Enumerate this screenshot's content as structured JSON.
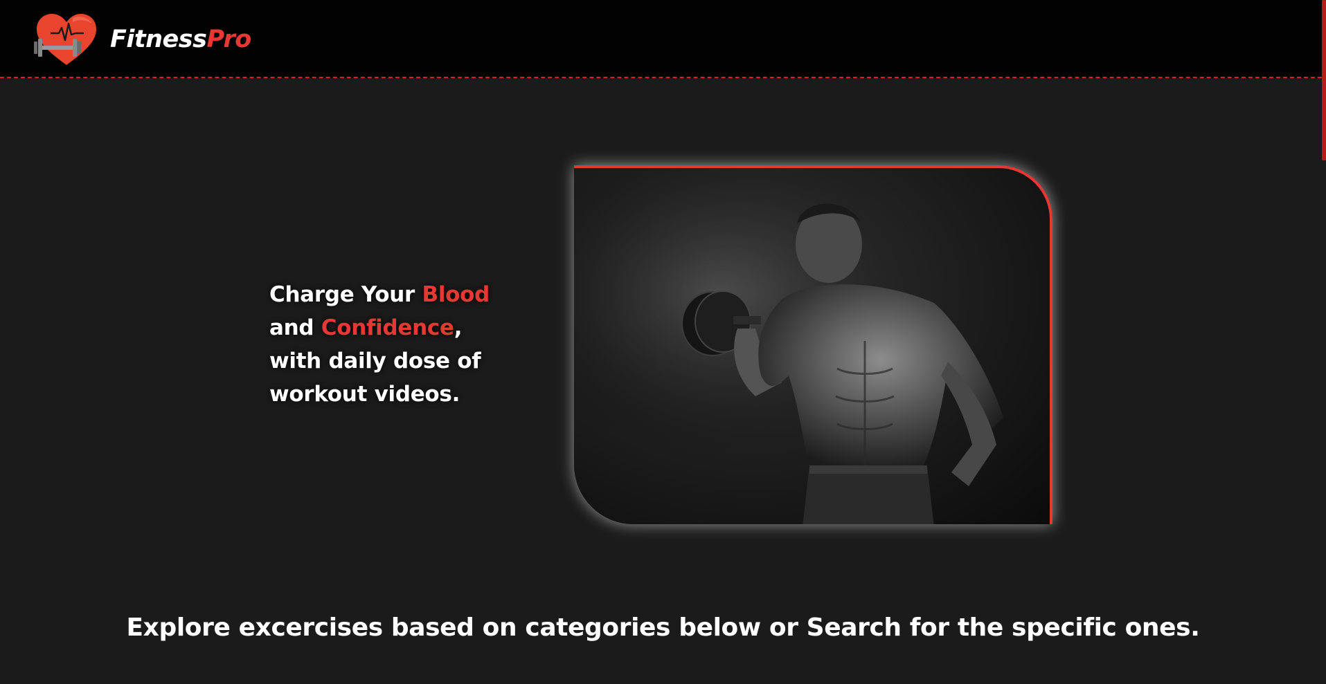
{
  "header": {
    "brand_part1": "Fitness",
    "brand_part2": "Pro",
    "logo_icon": "heart-dumbbell-icon"
  },
  "hero": {
    "line1_a": "Charge Your ",
    "line1_b": "Blood",
    "line2_a": "and ",
    "line2_b": "Confidence",
    "line2_c": ",",
    "line3": "with daily dose of",
    "line4": "workout videos.",
    "image": "bodybuilder-dumbbell-photo"
  },
  "explore": {
    "heading": "Explore excercises based on categories below or Search for the specific ones."
  },
  "colors": {
    "accent": "#e53935",
    "background": "#1b1b1b",
    "header_bg": "#020202",
    "text": "#ffffff"
  }
}
